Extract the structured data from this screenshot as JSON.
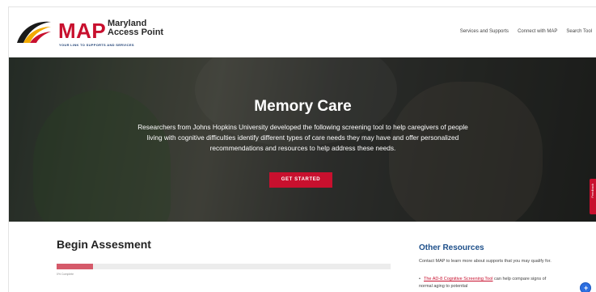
{
  "header": {
    "logo_text": "MAP",
    "logo_name_line1": "Maryland",
    "logo_name_line2": "Access Point",
    "logo_tagline": "YOUR LINK TO SUPPORTS AND SERVICES",
    "nav": [
      "Services and Supports",
      "Connect with MAP",
      "Search Tool"
    ]
  },
  "hero": {
    "title": "Memory Care",
    "text": "Researchers from Johns Hopkins University developed the following screening tool to help caregivers of people living with cognitive difficulties identify different types of care needs they may have and offer personalized recommendations and resources to help address these needs.",
    "button": "GET STARTED",
    "feedback": "Feedback"
  },
  "assessment": {
    "title": "Begin Assesment",
    "progress_percent": 11,
    "progress_label": "0% Complete"
  },
  "other_resources": {
    "title": "Other Resources",
    "text": "Contact MAP to learn more about supports that you may qualify for.",
    "link": "The AD-8 Cognitive Screening Tool",
    "link_suffix": " can help compare signs of normal aging to potential"
  },
  "colors": {
    "brand_red": "#c8102e",
    "link_blue": "#1d4f8a",
    "progress_fill": "#d55a6a"
  }
}
